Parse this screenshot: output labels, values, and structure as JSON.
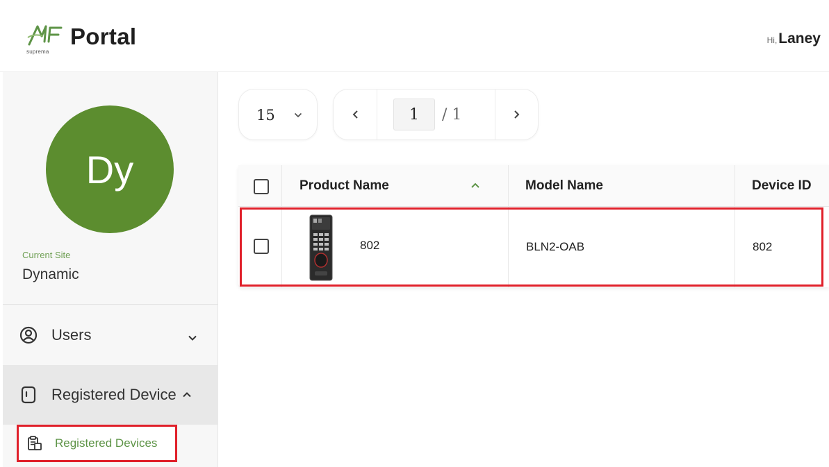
{
  "header": {
    "logo_brand": "suprema",
    "app_name": "Portal",
    "greeting_prefix": "Hi,",
    "user_name": "Laney"
  },
  "sidebar": {
    "avatar_initials": "Dy",
    "site_caption": "Current Site",
    "site_name": "Dynamic",
    "nav": [
      {
        "label": "Users",
        "icon": "user-circle-icon",
        "expanded": false
      },
      {
        "label": "Registered Device",
        "icon": "device-icon",
        "expanded": true
      }
    ],
    "sub_items": [
      {
        "label": "Registered Devices",
        "icon": "clipboard-icon",
        "active": true
      }
    ]
  },
  "pagination": {
    "page_size": "15",
    "current_page": "1",
    "total_pages": "/ 1"
  },
  "table": {
    "columns": [
      "Product Name",
      "Model Name",
      "Device ID"
    ],
    "sort": {
      "column": "Product Name",
      "direction": "ascending"
    },
    "rows": [
      {
        "product_name": "802",
        "model_name": "BLN2-OAB",
        "device_id": "802"
      }
    ]
  },
  "colors": {
    "accent_green": "#5e9447",
    "avatar_green": "#5c8d2f",
    "highlight_red": "#e0202a"
  }
}
